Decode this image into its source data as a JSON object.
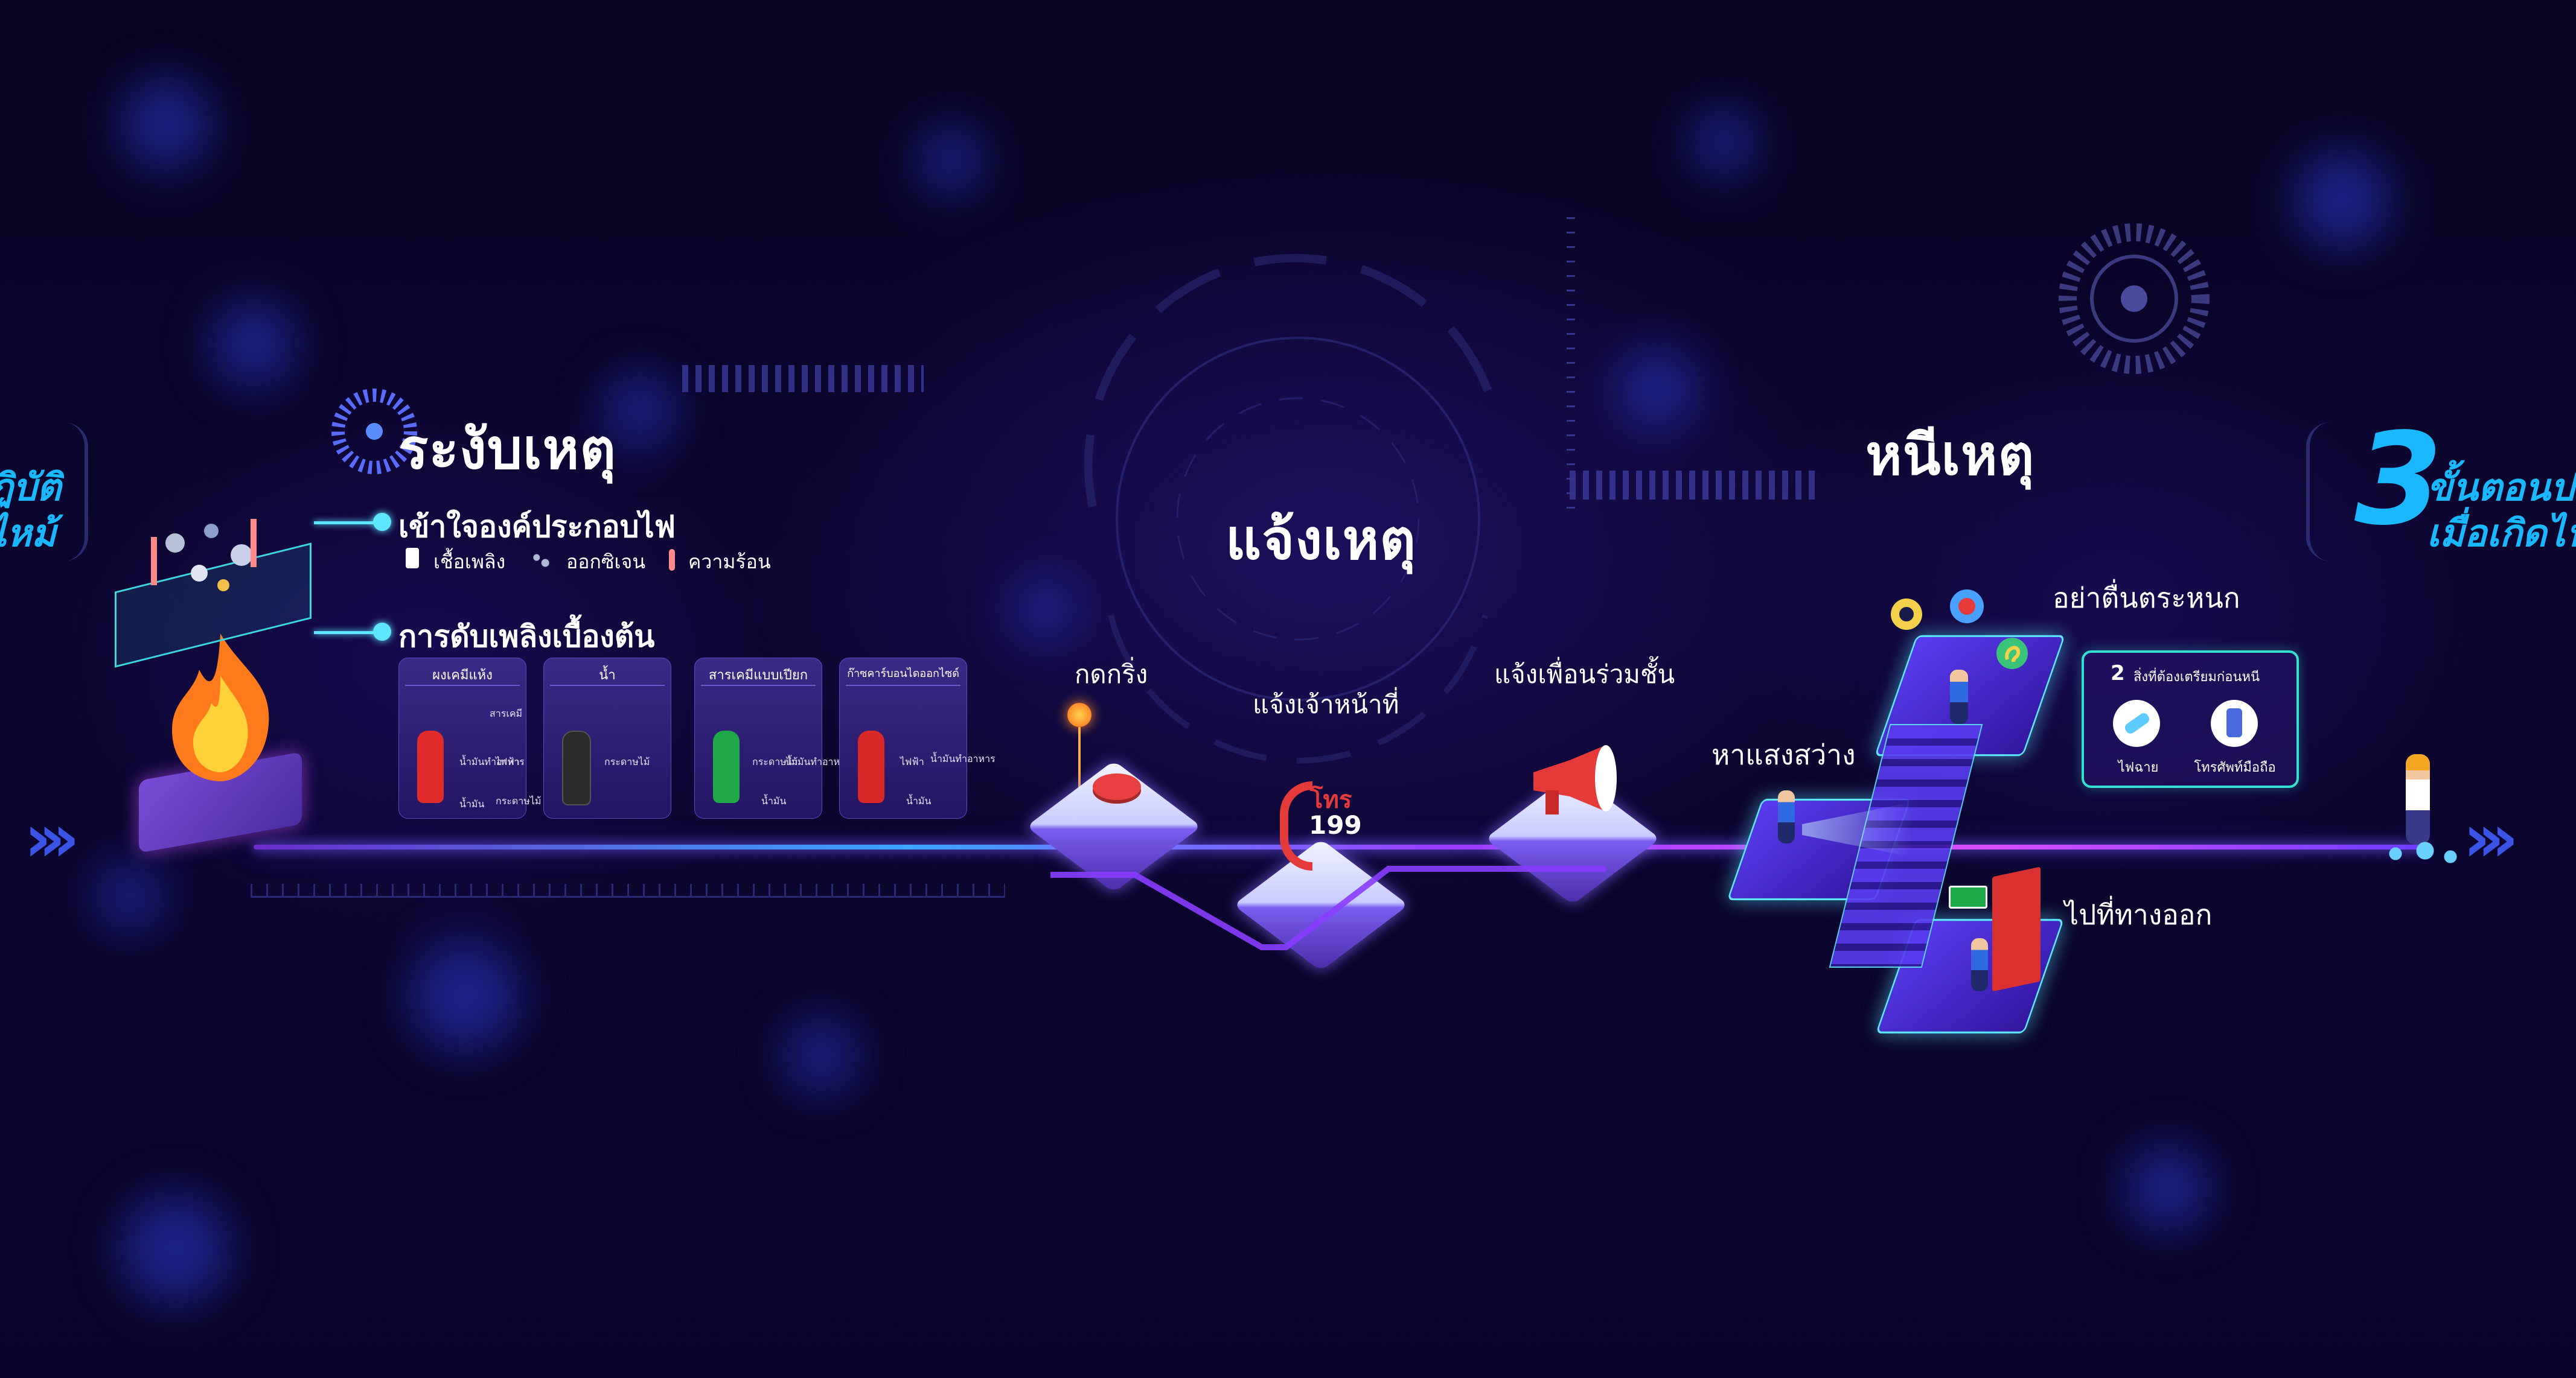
{
  "left_edge": {
    "line1": "ฏิบัติ",
    "line2": "ไหม้"
  },
  "suppress": {
    "title": "ระงับเหตุ",
    "understand": "เข้าใจองค์ประกอบไฟ",
    "elements": [
      {
        "label": "เชื้อเพลิง",
        "icon": "fuel-icon"
      },
      {
        "label": "ออกซิเจน",
        "icon": "oxygen-icon"
      },
      {
        "label": "ความร้อน",
        "icon": "heat-icon"
      }
    ],
    "basic_firefighting": "การดับเพลิงเบื้องต้น",
    "extinguishers": [
      {
        "name": "ผงเคมีแห้ง",
        "color": "#e12b2b",
        "uses": [
          "สารเคมี",
          "น้ำมันทำอาหาร",
          "ไฟฟ้า",
          "น้ำมัน",
          "กระดาษไม้"
        ]
      },
      {
        "name": "น้ำ",
        "color": "#2b2b2b",
        "uses": [
          "กระดาษไม้"
        ]
      },
      {
        "name": "สารเคมีแบบเปียก",
        "color": "#1fa84a",
        "uses": [
          "กระดาษไม้",
          "น้ำมันทำอาหาร",
          "น้ำมัน"
        ]
      },
      {
        "name": "ก๊าซคาร์บอนไดออกไซด์",
        "color": "#d92828",
        "uses": [
          "ไฟฟ้า",
          "น้ำมันทำอาหาร",
          "น้ำมัน"
        ]
      }
    ]
  },
  "report": {
    "title": "แจ้งเหตุ",
    "press_bell": "กดกริ่ง",
    "notify_staff": "แจ้งเจ้าหน้าที่",
    "phone_word": "โทร",
    "phone_number": "199",
    "notify_neighbors": "แจ้งเพื่อนร่วมชั้น"
  },
  "escape": {
    "title": "หนีเหตุ",
    "dont_panic": "อย่าตื่นตระหนก",
    "find_light": "หาแสงสว่าง",
    "go_exit": "ไปที่ทางออก",
    "prepare_title_num": "2",
    "prepare_title": "สิ่งที่ต้องเตรียมก่อนหนี",
    "prepare_items": [
      {
        "label": "ไฟฉาย",
        "icon": "flashlight-icon"
      },
      {
        "label": "โทรศัพท์มือถือ",
        "icon": "mobile-phone-icon"
      }
    ]
  },
  "headline": {
    "number": "3",
    "line1": "ขั้นตอนปฏิ",
    "line2": "เมื่อเกิดไฟ"
  },
  "colors": {
    "accent_cyan": "#5ee6ff",
    "accent_teal": "#34e0d0",
    "headline_blue": "#1ab8ff",
    "line_purple": "#9b3cff"
  }
}
